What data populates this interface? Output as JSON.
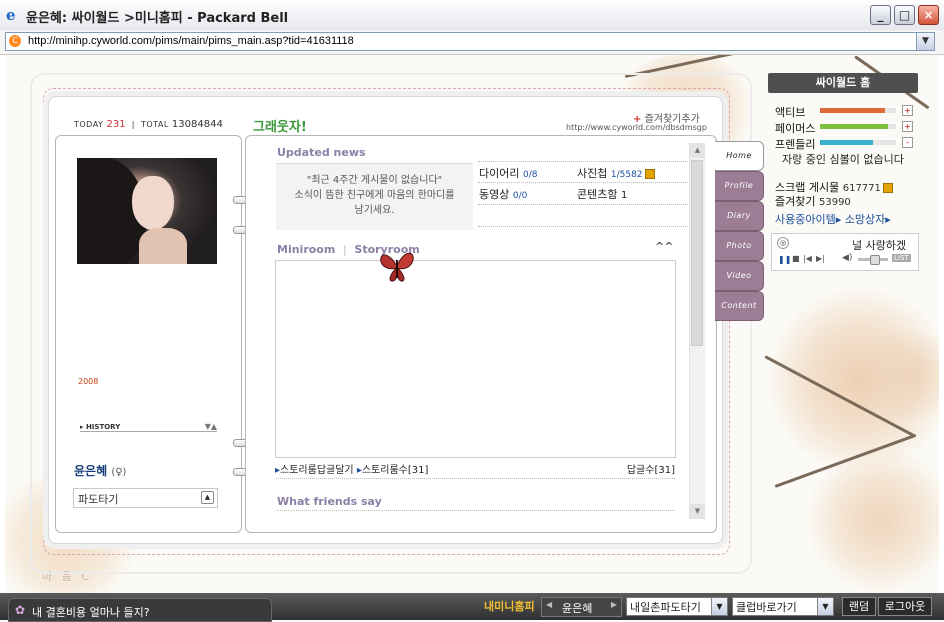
{
  "window": {
    "title": "윤은혜: 싸이월드 >미니홈피 - Packard Bell",
    "url": "http://minihp.cyworld.com/pims/main/pims_main.asp?tid=41631118"
  },
  "counter": {
    "today_label": "TODAY",
    "today_value": "231",
    "sep": "|",
    "total_label": "TOTAL",
    "total_value": "13084844"
  },
  "home_title": "그래웃자!",
  "favorite": {
    "label": "즐겨찾기추가",
    "url": "http://www.cyworld.com/dbsdmsgp"
  },
  "profile": {
    "year": "2008",
    "history_label": "HISTORY",
    "name": "윤은혜",
    "gender": "(♀)",
    "dropdown_value": "파도타기"
  },
  "updated": {
    "title": "Updated news",
    "message_lines": [
      "\"최근 4주간 게시물이 없습니다\"",
      "소식이 뜸한 친구에게 마음의 한마디를",
      "남기세요."
    ]
  },
  "stats": {
    "diary_label": "다이어리",
    "diary_value": "0/8",
    "photo_label": "사진첩",
    "photo_value": "1/5582",
    "video_label": "동영상",
    "video_value": "0/0",
    "contest_label": "콘텐츠함",
    "contest_value": "1"
  },
  "room": {
    "miniroom": "Miniroom",
    "sep": "|",
    "storyroom": "Storyroom",
    "collapse": "^^",
    "comment_link": "스토리룸답글달기",
    "count_link": "스토리룸수[31]",
    "reply_count": "답글수[31]"
  },
  "friends_title": "What friends say",
  "tabs": [
    "Home",
    "Profile",
    "Diary",
    "Photo",
    "Video",
    "Content"
  ],
  "right_panel": {
    "home_button": "싸이월드 홈",
    "stats": [
      {
        "label": "액티브",
        "value": 0.85,
        "color": "#e06a3a",
        "indicator": "+"
      },
      {
        "label": "페이머스",
        "value": 0.9,
        "color": "#7cbf3c",
        "indicator": "+"
      },
      {
        "label": "프렌들리",
        "value": 0.7,
        "color": "#3bb1d2",
        "indicator": "-"
      }
    ],
    "status_msg": "자랑 중인 심볼이 없습니다",
    "scrap_label": "스크랩 게시물",
    "scrap_value": "617771",
    "fav_label": "즐겨찾기",
    "fav_value": "53990",
    "link1": "사용중아이템",
    "link2": "소망상자",
    "bgm_title": "널 사랑하겠",
    "bgm_list_btn": "LIST"
  },
  "watermark": "마 음 C",
  "bottom": {
    "message": "내 결혼비용 얼마나 들지?",
    "my_hp": "내미니홈피",
    "name": "윤은혜",
    "select1": "내일촌파도타기",
    "select2": "클럽바로가기",
    "random": "랜덤",
    "logout": "로그아웃"
  }
}
